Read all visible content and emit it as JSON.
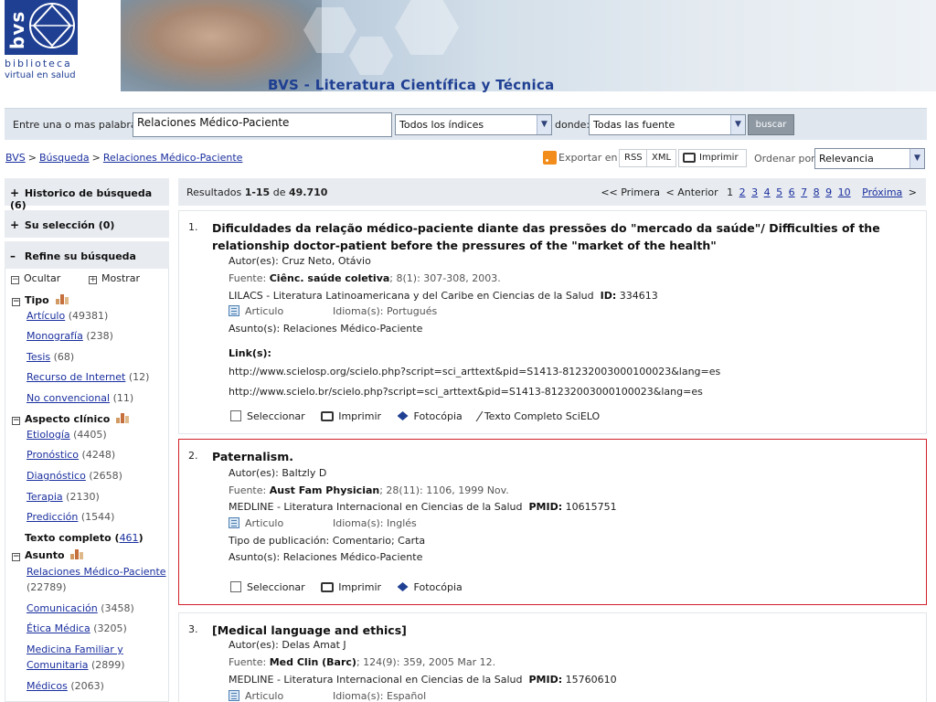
{
  "header": {
    "logo_mark": "bvs",
    "logo_line1": "biblioteca",
    "logo_line2": "virtual en salud",
    "banner_title": "BVS - Literatura Científica y Técnica"
  },
  "search": {
    "label": "Entre una o mas palabras",
    "value": "Relaciones Médico-Paciente",
    "indices": "Todos los índices",
    "donde_label": "donde:",
    "fuente": "Todas las fuente",
    "button": "buscar"
  },
  "breadcrumb": [
    "BVS",
    "Búsqueda",
    "Relaciones Médico-Paciente"
  ],
  "breadcrumb_sep": ">",
  "tools": {
    "exportar": "Exportar en",
    "rss": "RSS",
    "xml": "XML",
    "imprimir": "Imprimir",
    "ordenar": "Ordenar por",
    "orden_value": "Relevancia"
  },
  "sidebar": {
    "historico": "Historico de búsqueda",
    "historico_count": "(6)",
    "seleccion": "Su selección",
    "seleccion_count": "(0)",
    "refine": "Refine su búsqueda",
    "ocultar": "Ocultar",
    "mostrar": "Mostrar",
    "tipo": {
      "label": "Tipo",
      "items": [
        {
          "label": "Artículo",
          "count": "(49381)"
        },
        {
          "label": "Monografía",
          "count": "(238)"
        },
        {
          "label": "Tesis",
          "count": "(68)"
        },
        {
          "label": "Recurso de Internet",
          "count": "(12)"
        },
        {
          "label": "No convencional",
          "count": "(11)"
        }
      ]
    },
    "aspecto": {
      "label": "Aspecto clínico",
      "items": [
        {
          "label": "Etiología",
          "count": "(4405)"
        },
        {
          "label": "Pronóstico",
          "count": "(4248)"
        },
        {
          "label": "Diagnóstico",
          "count": "(2658)"
        },
        {
          "label": "Terapia",
          "count": "(2130)"
        },
        {
          "label": "Predicción",
          "count": "(1544)"
        }
      ]
    },
    "texto": {
      "label": "Texto completo (",
      "count": "461",
      "close": ")"
    },
    "asunto": {
      "label": "Asunto",
      "items": [
        {
          "label": "Relaciones Médico-Paciente",
          "count": "(22789)"
        },
        {
          "label": "Comunicación",
          "count": "(3458)"
        },
        {
          "label": "Ética Médica",
          "count": "(3205)"
        },
        {
          "label": "Medicina Familiar y",
          "label2": "Comunitaria",
          "count": "(2899)"
        },
        {
          "label": "Médicos",
          "count": "(2063)"
        }
      ]
    }
  },
  "results_bar": {
    "prefix": "Resultados",
    "range": "1-15",
    "de": "de",
    "total": "49.710",
    "primera": "<< Primera",
    "anterior": "< Anterior",
    "current": "1",
    "pages": [
      "2",
      "3",
      "4",
      "5",
      "6",
      "7",
      "8",
      "9",
      "10"
    ],
    "proxima": "Próxima",
    "next_arrow": ">"
  },
  "labels": {
    "autor": "Autor(es):",
    "fuente": "Fuente:",
    "idioma": "Idioma(s):",
    "asunto": "Asunto(s):",
    "links": "Link(s):",
    "tipo_pub": "Tipo de publicación:",
    "seleccionar": "Seleccionar",
    "imprimir": "Imprimir",
    "fotocopia": "Fotocópia",
    "texto_completo": "Texto Completo SciELO"
  },
  "results": [
    {
      "num": "1.",
      "title": "Dificuldades da relação médico-paciente diante das pressões do \"mercado da saúde\"/ Difficulties of the relationship doctor-patient before the pressures of the \"market of the health\"",
      "autor": "Cruz Neto, Otávio",
      "fuente_journal": "Ciênc. saúde coletiva",
      "fuente_rest": "; 8(1): 307-308, 2003.",
      "base": "LILACS - Literatura Latinoamericana y del Caribe en Ciencias de la Salud",
      "id_label": "ID:",
      "id_value": "334613",
      "doc_type": "Articulo",
      "idioma": "Portugués",
      "asunto": "Relaciones Médico-Paciente",
      "link1": "http://www.scielosp.org/scielo.php?script=sci_arttext&pid=S1413-81232003000100023&lang=es",
      "link2": "http://www.scielo.br/scielo.php?script=sci_arttext&pid=S1413-81232003000100023&lang=es"
    },
    {
      "num": "2.",
      "title": "Paternalism.",
      "autor": "Baltzly D",
      "fuente_journal": "Aust Fam Physician",
      "fuente_rest": "; 28(11): 1106, 1999 Nov.",
      "base": "MEDLINE - Literatura Internacional en Ciencias de la Salud",
      "id_label": "PMID:",
      "id_value": "10615751",
      "doc_type": "Articulo",
      "idioma": "Inglés",
      "tipo_pub": "Comentario; Carta",
      "asunto": "Relaciones Médico-Paciente"
    },
    {
      "num": "3.",
      "title": "[Medical language and ethics]",
      "autor": "Delas Amat J",
      "fuente_journal": "Med Clin (Barc)",
      "fuente_rest": "; 124(9): 359, 2005 Mar 12.",
      "base": "MEDLINE - Literatura Internacional en Ciencias de la Salud",
      "id_label": "PMID:",
      "id_value": "15760610",
      "doc_type": "Articulo",
      "idioma": "Español"
    }
  ],
  "colors": {
    "brand": "#1f3f93",
    "link": "#1a2f9e",
    "highlight": "#d21e28",
    "panel": "#e8ecf0"
  }
}
